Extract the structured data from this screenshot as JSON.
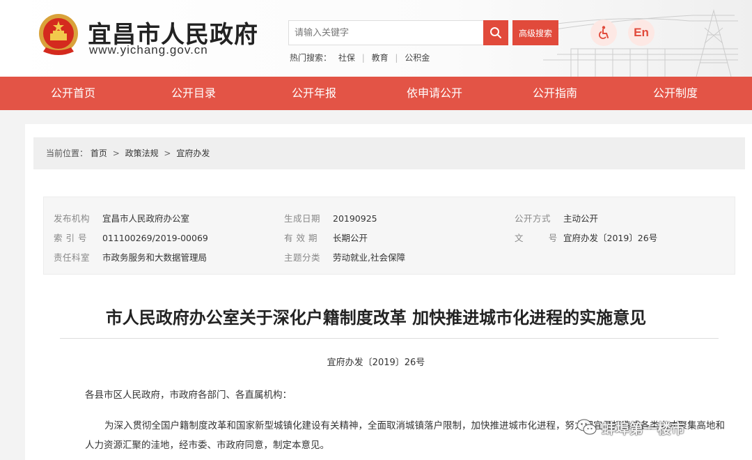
{
  "header": {
    "site_title": "宜昌市人民政府",
    "site_url": "www.yichang.gov.cn",
    "search_placeholder": "请输入关键字",
    "advanced_search": "高级搜索",
    "hot_label": "热门搜索：",
    "hot_keywords": [
      "社保",
      "教育",
      "公积金"
    ],
    "en_label": "En",
    "icons": {
      "search": "search-icon",
      "accessibility": "accessibility-icon",
      "emblem": "national-emblem-icon"
    },
    "accent_color": "#e35446"
  },
  "nav": {
    "items": [
      "公开首页",
      "公开目录",
      "公开年报",
      "依申请公开",
      "公开指南",
      "公开制度"
    ]
  },
  "breadcrumb": {
    "label": "当前位置：",
    "items": [
      "首页",
      "政策法规",
      "宜府办发"
    ],
    "separator": ">"
  },
  "meta": {
    "publisher_label": "发布机构",
    "publisher": "宜昌市人民政府办公室",
    "date_label": "生成日期",
    "date": "20190925",
    "open_mode_label": "公开方式",
    "open_mode": "主动公开",
    "index_label": "索 引 号",
    "index": "011100269/2019-00069",
    "validity_label": "有 效 期",
    "validity": "长期公开",
    "doc_no_label": "文        号",
    "doc_no": "宜府办发〔2019〕26号",
    "responsible_label": "责任科室",
    "responsible": "市政务服务和大数据管理局",
    "category_label": "主题分类",
    "category": "劳动就业,社会保障"
  },
  "document": {
    "title": "市人民政府办公室关于深化户籍制度改革 加快推进城市化进程的实施意见",
    "number": "宜府办发〔2019〕26号",
    "salutation": "各县市区人民政府，市政府各部门、各直属机构：",
    "paragraph_1": "为深入贯彻全国户籍制度改革和国家新型城镇化建设有关精神，全面取消城镇落户限制，加快推进城市化进程，努力把宜昌打造成各类人才聚集高地和人力资源汇聚的洼地，经市委、市政府同意，制定本意见。"
  },
  "watermark": {
    "text": "蚌埠第一楼市",
    "icon": "wechat-icon"
  }
}
